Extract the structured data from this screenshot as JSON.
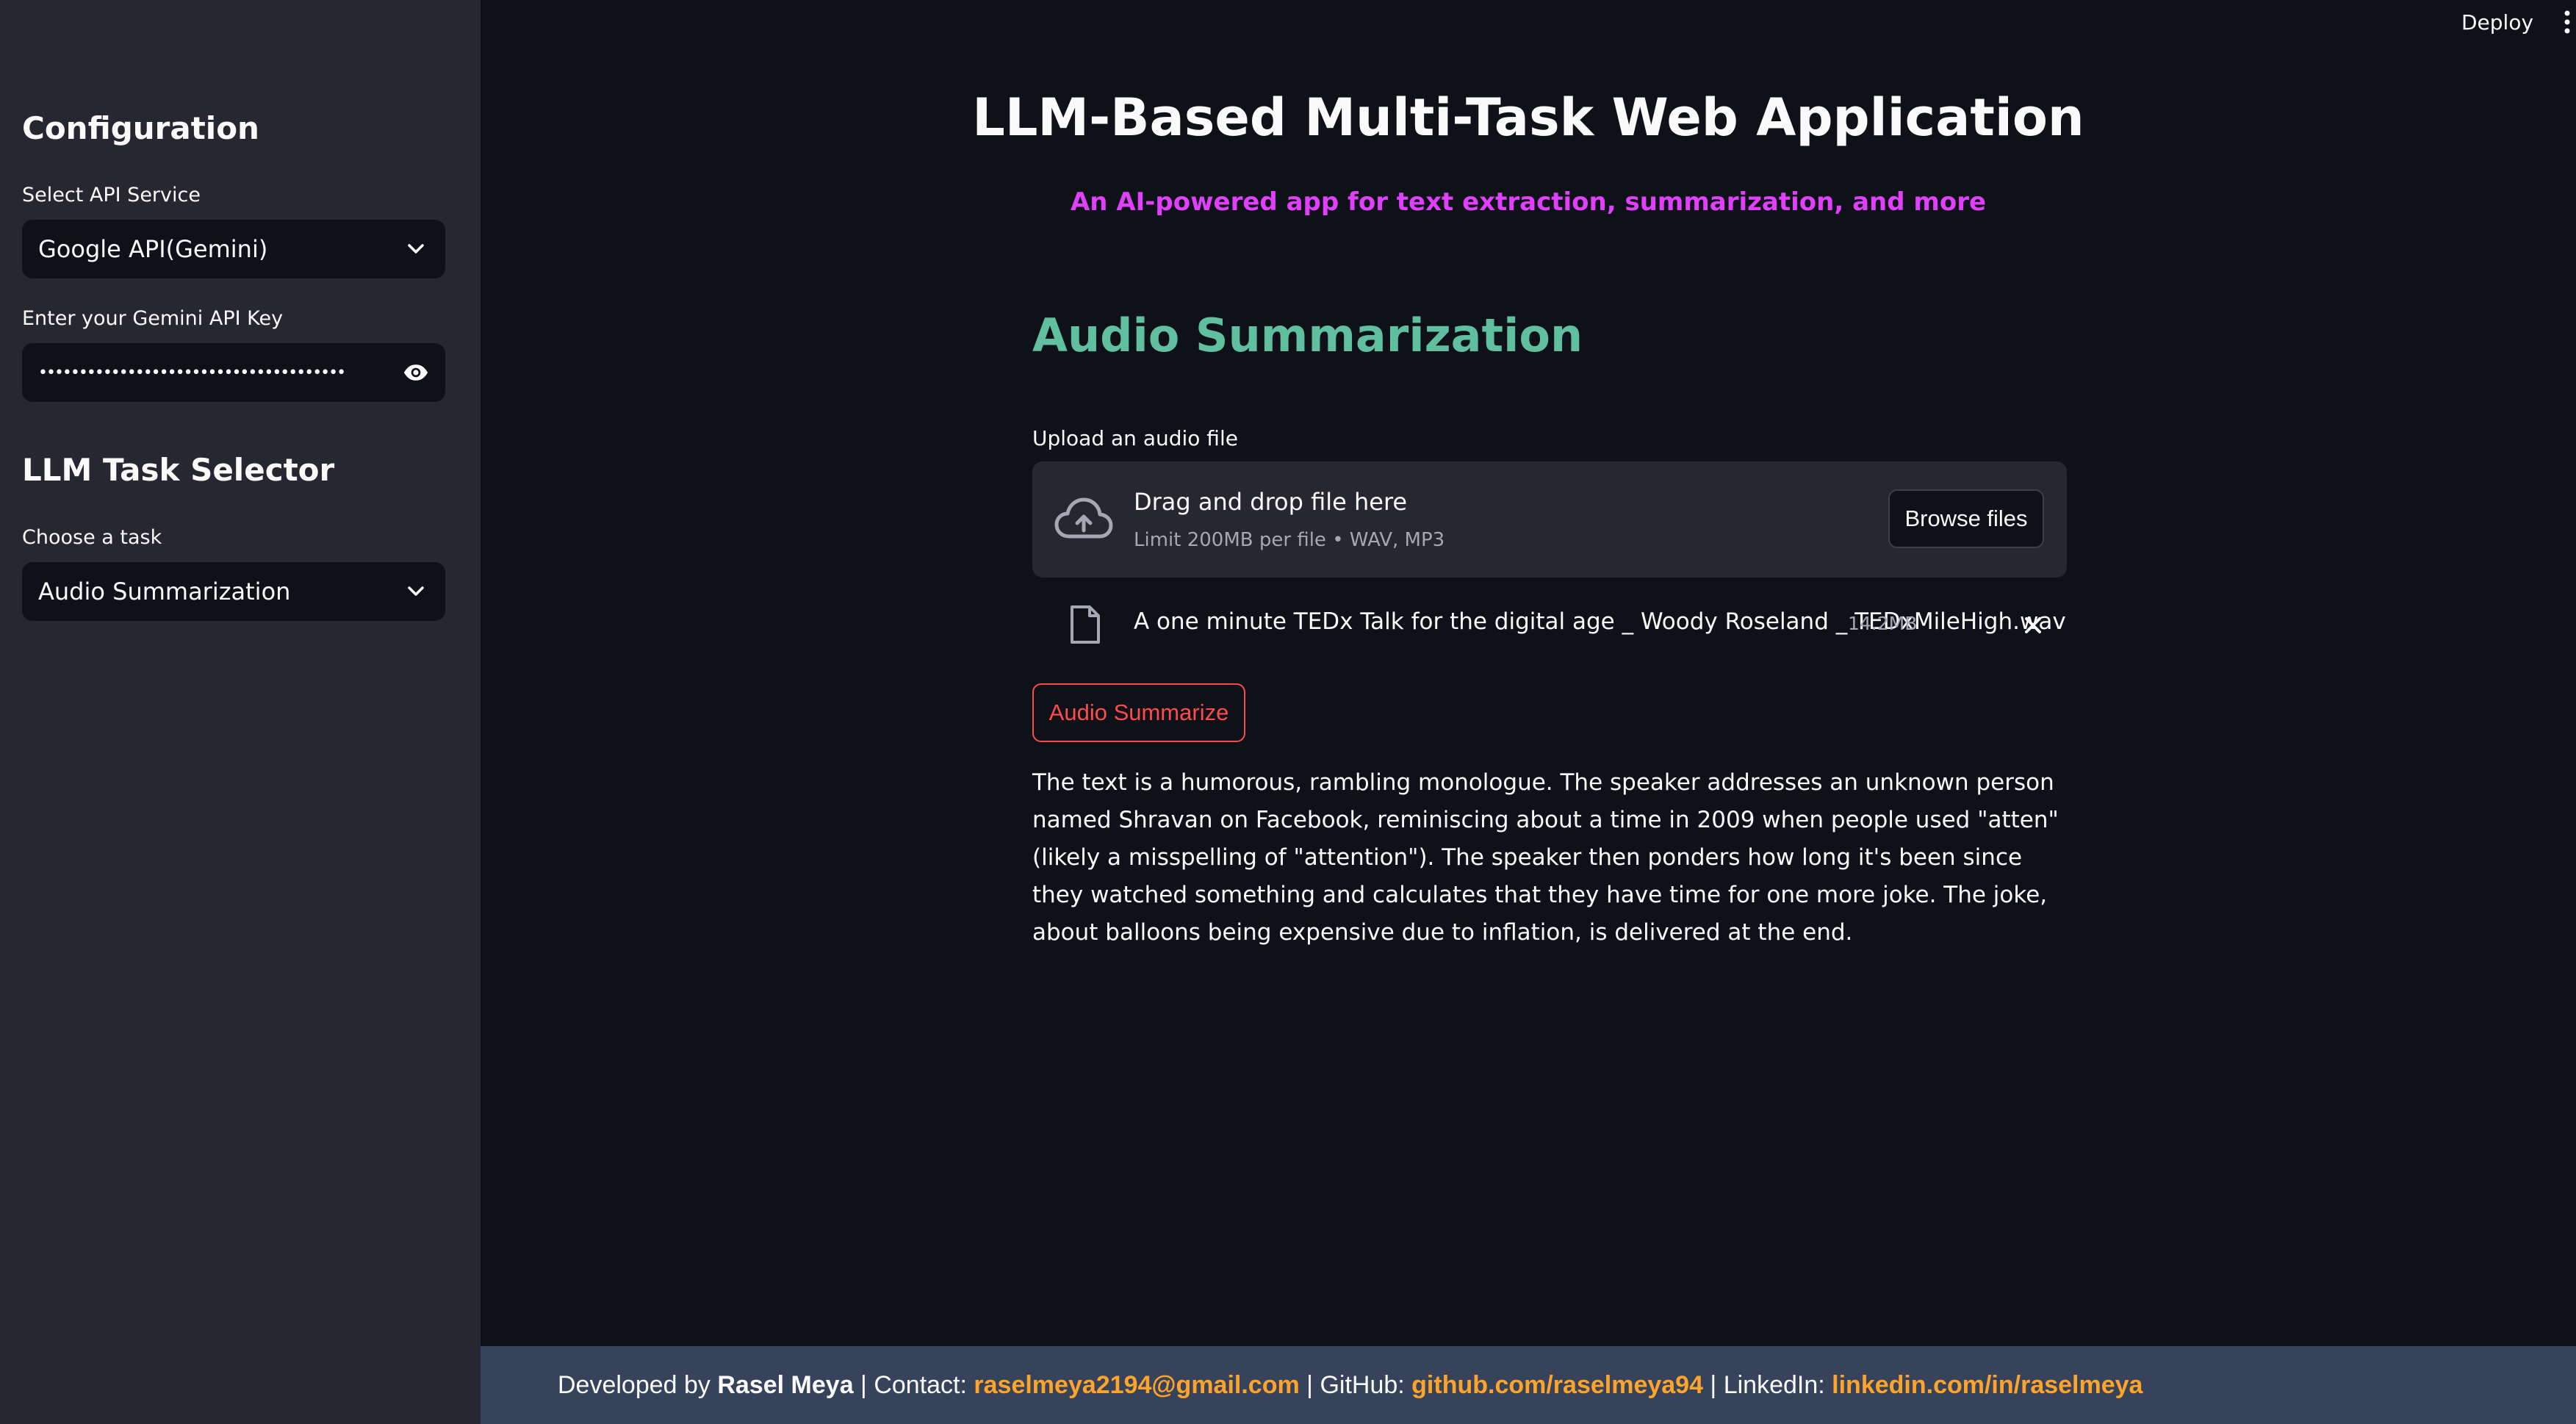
{
  "header": {
    "deploy_label": "Deploy"
  },
  "sidebar": {
    "config_heading": "Configuration",
    "api_service_label": "Select API Service",
    "api_service_value": "Google API(Gemini)",
    "api_key_label": "Enter your Gemini API Key",
    "api_key_masked": "••••••••••••••••••••••••••••••••••••••",
    "task_heading": "LLM Task Selector",
    "task_label": "Choose a task",
    "task_value": "Audio Summarization"
  },
  "main": {
    "title": "LLM-Based Multi-Task Web Application",
    "subtitle": "An AI-powered app for text extraction, summarization, and more",
    "section_title": "Audio Summarization",
    "upload_label": "Upload an audio file",
    "dropzone_main": "Drag and drop file here",
    "dropzone_sub": "Limit 200MB per file • WAV, MP3",
    "browse_label": "Browse files",
    "file": {
      "name": "A one minute TEDx Talk for the digital age _ Woody Roseland _ TEDxMileHigh.wav",
      "size": "14.2MB"
    },
    "action_label": "Audio Summarize",
    "result_text": "The text is a humorous, rambling monologue. The speaker addresses an unknown person named Shravan on Facebook, reminiscing about a time in 2009 when people used \"atten\" (likely a misspelling of \"attention\"). The speaker then ponders how long it's been since they watched something and calculates that they have time for one more joke. The joke, about balloons being expensive due to inflation, is delivered at the end."
  },
  "footer": {
    "developed_by": "Developed by ",
    "author": "Rasel Meya",
    "contact_label": " | Contact: ",
    "email": "raselmeya2194@gmail.com",
    "github_label": " | GitHub: ",
    "github": "github.com/raselmeya94",
    "linkedin_label": " | LinkedIn: ",
    "linkedin": "linkedin.com/in/raselmeya"
  },
  "colors": {
    "background": "#0e1117",
    "sidebar": "#262730",
    "subtitle": "#e040fb",
    "section_title": "#5fbf9f",
    "primary_button": "#ff4b4b",
    "footer_bg": "#36435a",
    "footer_link": "#ffa42b"
  },
  "icons": [
    "chevron-down-icon",
    "eye-icon",
    "cloud-upload-icon",
    "file-icon",
    "close-icon",
    "kebab-menu-icon"
  ]
}
